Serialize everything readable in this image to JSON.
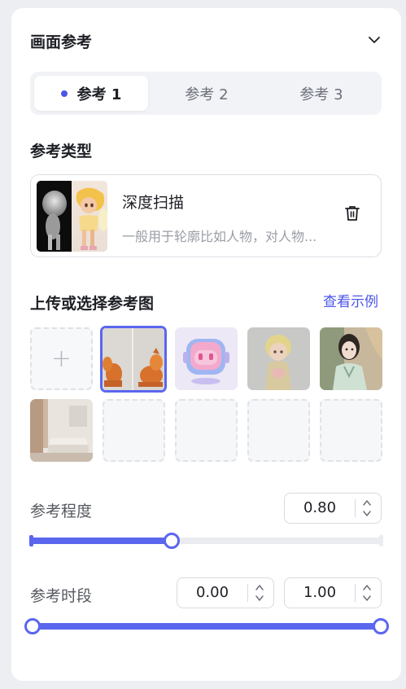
{
  "section": {
    "title": "画面参考"
  },
  "tabs": [
    {
      "label": "参考 1",
      "active": true
    },
    {
      "label": "参考 2",
      "active": false
    },
    {
      "label": "参考 3",
      "active": false
    }
  ],
  "ref_type": {
    "heading": "参考类型",
    "name": "深度扫描",
    "description": "一般用于轮廓比如人物，对人物..."
  },
  "upload": {
    "heading": "上传或选择参考图",
    "example_link": "查看示例",
    "add_symbol": "+",
    "images": [
      {
        "name": "orange-dogs",
        "selected": true
      },
      {
        "name": "pink-robot",
        "selected": false
      },
      {
        "name": "cartoon-girl",
        "selected": false
      },
      {
        "name": "hanfu-woman",
        "selected": false
      },
      {
        "name": "living-room",
        "selected": false
      }
    ],
    "empty_slots": 4
  },
  "strength": {
    "label": "参考程度",
    "value": "0.80",
    "fraction": 0.4
  },
  "period": {
    "label": "参考时段",
    "start": "0.00",
    "end": "1.00",
    "start_fraction": 0.0,
    "end_fraction": 1.0
  },
  "colors": {
    "accent": "#5b66ee",
    "dot": "#4a55e8",
    "link": "#4a55e8"
  }
}
